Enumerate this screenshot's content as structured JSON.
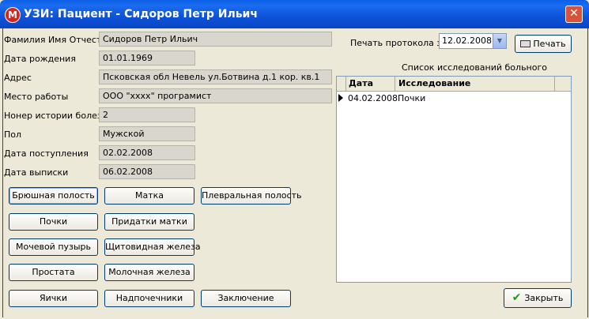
{
  "window": {
    "title": "УЗИ: Пациент - Сидоров Петр Ильич",
    "close_glyph": "✕",
    "app_icon_letter": "M"
  },
  "patient": {
    "fields": [
      {
        "label": "Фамилия Имя Отчество",
        "value": "Сидоров Петр Ильич"
      },
      {
        "label": "Дата рождения",
        "value": "01.01.1969"
      },
      {
        "label": "Адрес",
        "value": "Псковская обл  Невель  ул.Ботвина д.1 кор. кв.1"
      },
      {
        "label": "Место работы",
        "value": "ООО \"хххх\" програмист"
      },
      {
        "label": "Нонер истории болезни",
        "value": "2"
      },
      {
        "label": "Пол",
        "value": "Мужской"
      },
      {
        "label": "Дата поступления",
        "value": "02.02.2008"
      },
      {
        "label": "Дата выписки",
        "value": "06.02.2008"
      }
    ]
  },
  "exam_buttons": [
    "Брюшная полость",
    "Матка",
    "Плевральная полость",
    "Почки",
    "Придатки матки",
    "Мочевой пузырь",
    "Щитовидная железа",
    "Простата",
    "Молочная железа",
    "Яички",
    "Надпочечники",
    "Заключение"
  ],
  "print": {
    "label": "Печать протокола за",
    "date": "12.02.2008",
    "button_label": "Печать"
  },
  "studies": {
    "title": "Список исследований больного",
    "columns": [
      "Дата",
      "Исследование"
    ],
    "rows": [
      {
        "date": "04.02.2008",
        "exam": "Почки"
      }
    ]
  },
  "close_button_label": "Закрыть"
}
